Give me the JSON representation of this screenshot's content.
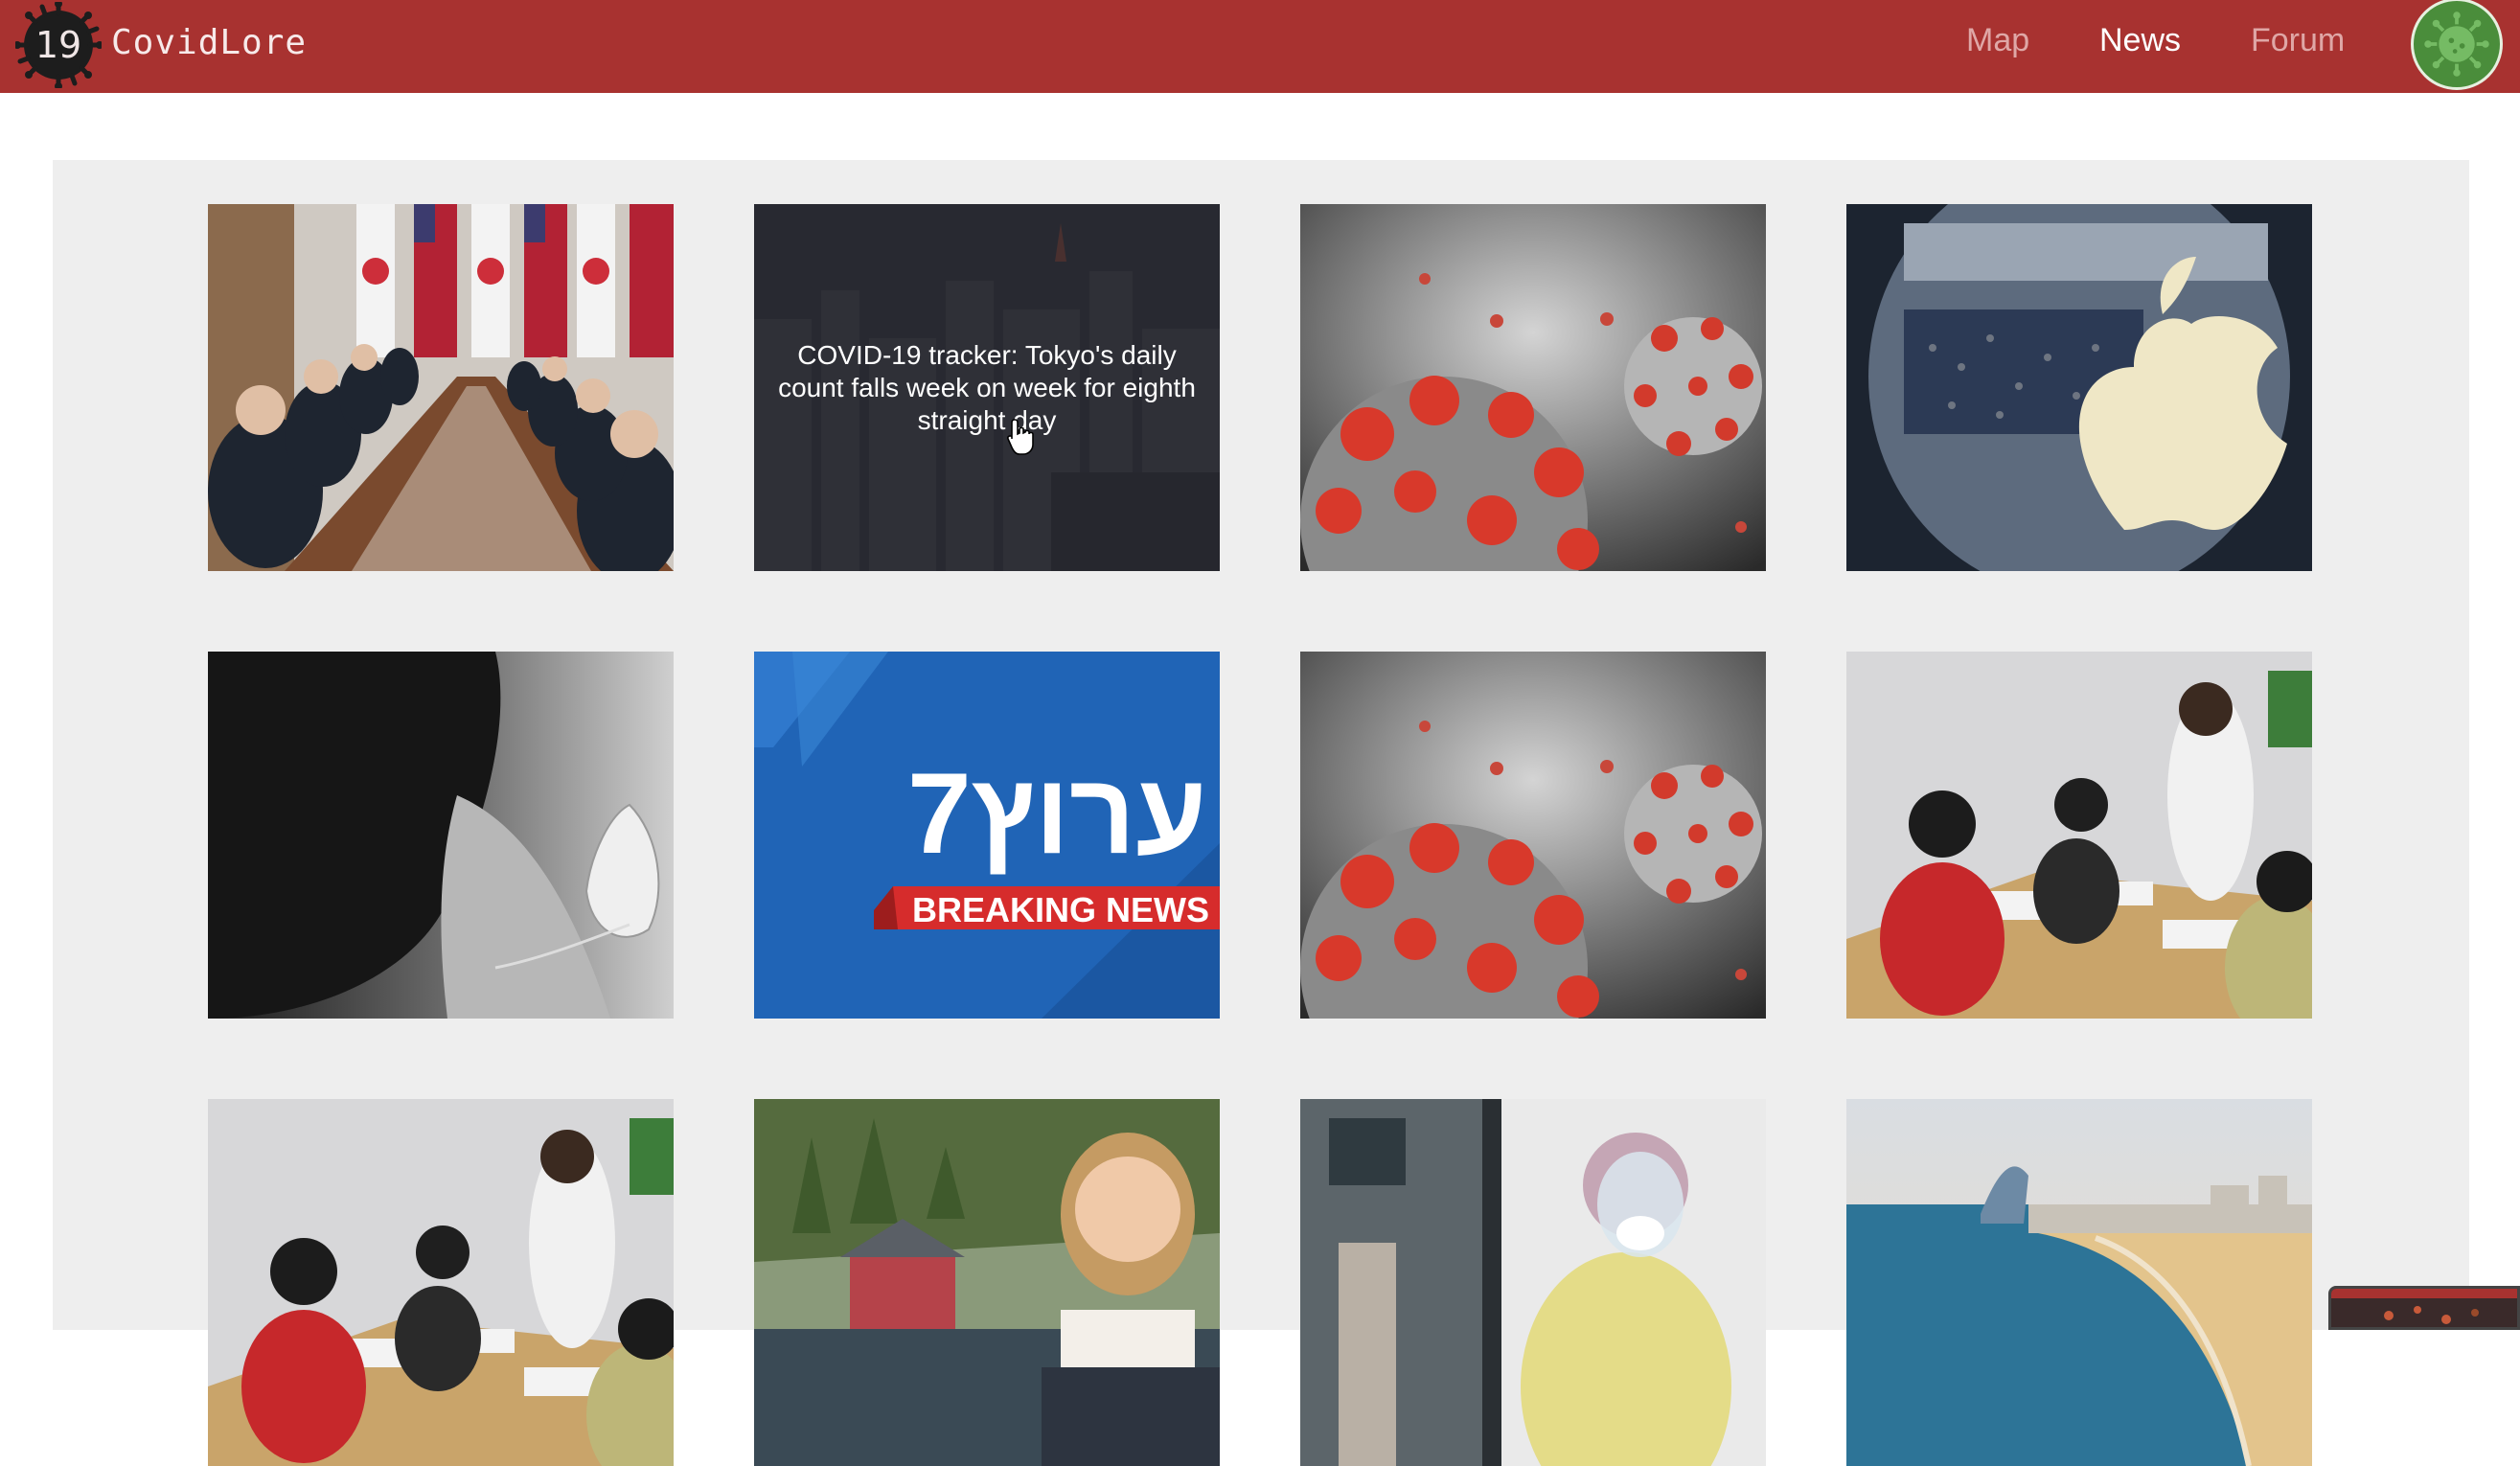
{
  "header": {
    "logo_number": "19",
    "brand": "CovidLore",
    "nav": [
      {
        "label": "Map",
        "active": false
      },
      {
        "label": "News",
        "active": true
      },
      {
        "label": "Forum",
        "active": false
      }
    ],
    "colors": {
      "bar": "#a83230",
      "active_link": "#ffffff",
      "inactive_link": "#dfa7a6"
    }
  },
  "news": {
    "hover_title": "COVID-19 tracker: Tokyo's daily count falls week on week for eighth straight day",
    "breaking_brand": "7ערוץ",
    "breaking_label": "BREAKING NEWS",
    "cards": [
      {
        "image": "officials-meeting-with-flags"
      },
      {
        "image": "tokyo-night-skyline",
        "hovered": true
      },
      {
        "image": "coronavirus-particles"
      },
      {
        "image": "apple-store-logo"
      },
      {
        "image": "woman-with-mask-bw"
      },
      {
        "image": "channel-7-breaking-news"
      },
      {
        "image": "coronavirus-particles"
      },
      {
        "image": "students-classroom-masks"
      },
      {
        "image": "students-classroom-masks"
      },
      {
        "image": "smiling-girl-harbor"
      },
      {
        "image": "nurse-ppe-hospital"
      },
      {
        "image": "barcelona-beach-aerial"
      }
    ]
  }
}
